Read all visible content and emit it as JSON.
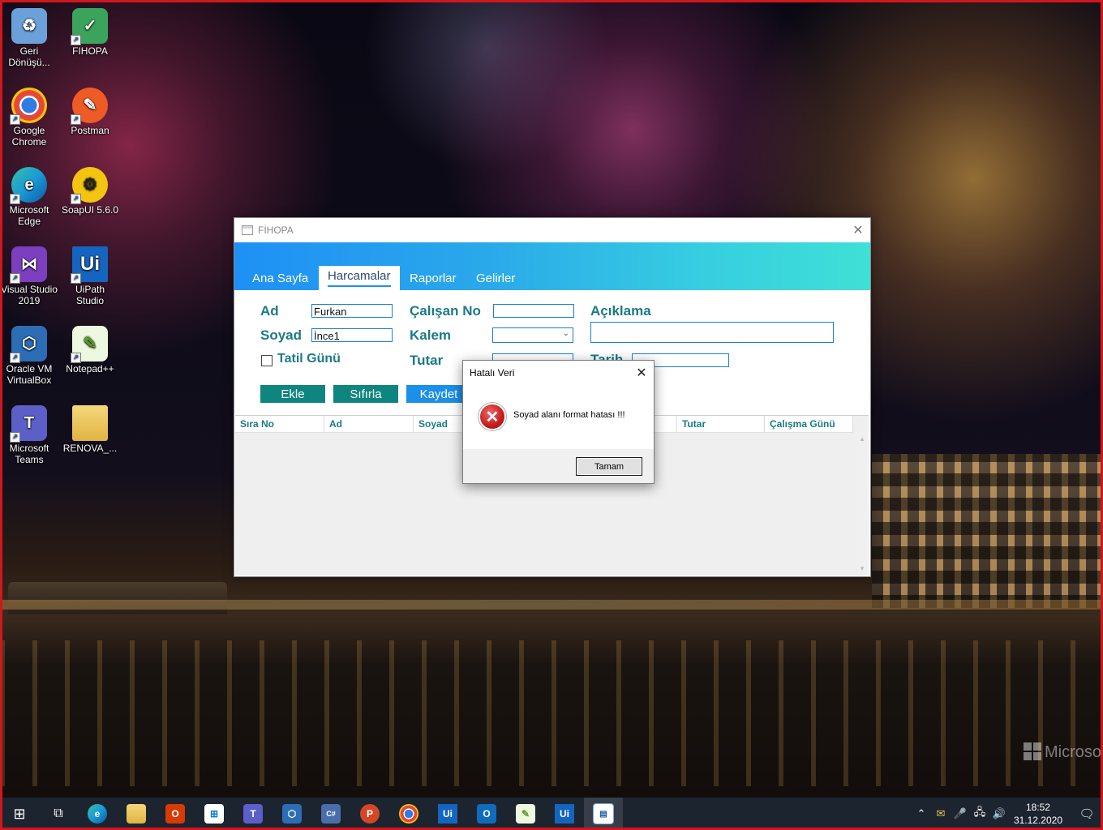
{
  "desktop": {
    "icons": [
      {
        "label": "Geri Dönüşü...",
        "icon": "recycle-bin-icon",
        "color": "#6ba0d8"
      },
      {
        "label": "FIHOPA",
        "icon": "fihopa-icon",
        "color": "#3aa35c"
      },
      {
        "label": "Google Chrome",
        "icon": "chrome-icon",
        "color": "#2f7de1"
      },
      {
        "label": "Postman",
        "icon": "postman-icon",
        "color": "#ef5b25"
      },
      {
        "label": "Microsoft Edge",
        "icon": "edge-icon",
        "color": "#1a9ad6"
      },
      {
        "label": "SoapUI 5.6.0",
        "icon": "soapui-icon",
        "color": "#f3c511"
      },
      {
        "label": "Visual Studio 2019",
        "icon": "visual-studio-icon",
        "color": "#7b3fbf"
      },
      {
        "label": "UiPath Studio",
        "icon": "uipath-icon",
        "color": "#1565c0"
      },
      {
        "label": "Oracle VM VirtualBox",
        "icon": "virtualbox-icon",
        "color": "#2c6db5"
      },
      {
        "label": "Notepad++",
        "icon": "notepadpp-icon",
        "color": "#8bc34a"
      },
      {
        "label": "Microsoft Teams",
        "icon": "teams-icon",
        "color": "#5b5fc7"
      },
      {
        "label": "RENOVA_...",
        "icon": "folder-icon",
        "color": "#e8c25a"
      }
    ],
    "watermark": "Microso"
  },
  "app": {
    "title": "FİHOPA",
    "tabs": [
      "Ana Sayfa",
      "Harcamalar",
      "Raporlar",
      "Gelirler"
    ],
    "active_tab": "Harcamalar",
    "form": {
      "ad_label": "Ad",
      "ad_value": "Furkan",
      "soyad_label": "Soyad",
      "soyad_value": "İnce1",
      "tatil_label": "Tatil Günü",
      "calisan_label": "Çalışan No",
      "calisan_value": "",
      "kalem_label": "Kalem",
      "kalem_value": "",
      "tutar_label": "Tutar",
      "aciklama_label": "Açıklama",
      "aciklama_value": "",
      "tarih_label": "Tarih",
      "tarih_value": ""
    },
    "buttons": {
      "ekle": "Ekle",
      "sifirla": "Sıfırla",
      "kaydet": "Kaydet"
    },
    "grid_columns": [
      "Sıra No",
      "Ad",
      "Soyad",
      "",
      "",
      "Tutar",
      "Çalışma Günü"
    ]
  },
  "dialog": {
    "title": "Hatalı Veri",
    "message": "Soyad alanı format hatası !!!",
    "ok_label": "Tamam"
  },
  "taskbar": {
    "time": "18:52",
    "date": "31.12.2020",
    "apps": [
      "start-icon",
      "task-view-icon",
      "edge-icon",
      "file-explorer-icon",
      "office-icon",
      "store-icon",
      "teams-icon",
      "virtualbox-icon",
      "calculator-icon",
      "powerpoint-icon",
      "chrome-icon",
      "uipath-icon",
      "outlook-icon",
      "notepadpp-icon",
      "uipath-icon",
      "app-window-icon"
    ]
  }
}
